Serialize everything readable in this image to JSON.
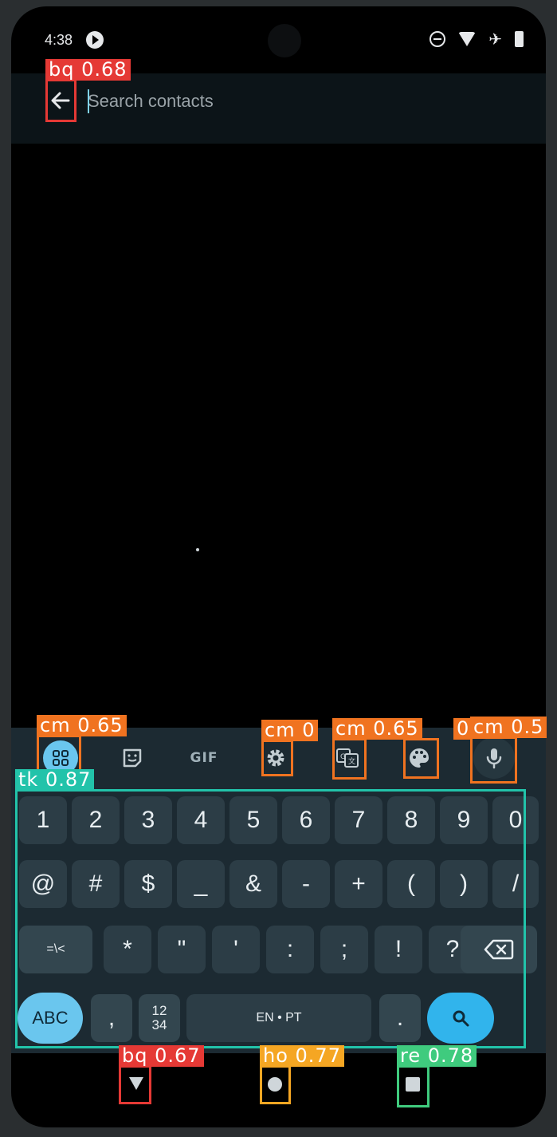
{
  "status_bar": {
    "time": "4:38"
  },
  "search": {
    "placeholder": "Search contacts"
  },
  "keyboard": {
    "toolbar": {
      "gif_label": "GIF"
    },
    "row1": [
      "1",
      "2",
      "3",
      "4",
      "5",
      "6",
      "7",
      "8",
      "9",
      "0"
    ],
    "row2": [
      "@",
      "#",
      "$",
      "_",
      "&",
      "-",
      "+",
      "(",
      ")",
      "/"
    ],
    "row3": {
      "symbols_toggle": "=\\<",
      "keys": [
        "*",
        "\"",
        "'",
        ":",
        ";",
        "!",
        "?"
      ]
    },
    "row4": {
      "abc_label": "ABC",
      "comma": ",",
      "fraction_top": "12",
      "fraction_bottom": "34",
      "space_label": "EN • PT",
      "period": "."
    }
  },
  "annotations": {
    "back_top": "bq  0.68",
    "apps": "cm  0.65",
    "settings": "cm  0",
    "translate": "cm  0.65",
    "theme": "0",
    "voice": "cm  0.5",
    "keyboard_region": "tk  0.87",
    "nav_back": "bq  0.67",
    "nav_home": "ho  0.77",
    "nav_recents": "re  0.78"
  },
  "colors": {
    "screen_background": "#000000",
    "search_bar_background": "#0c1418",
    "keyboard_background": "#1c2a32",
    "key_background": "#2c3d46",
    "accent_blue": "#6ac6ee",
    "annot_red": "#e53935",
    "annot_orange": "#f07320",
    "annot_teal": "#22c3aa",
    "annot_yellow": "#f5a623",
    "annot_green": "#3fcb7e"
  }
}
